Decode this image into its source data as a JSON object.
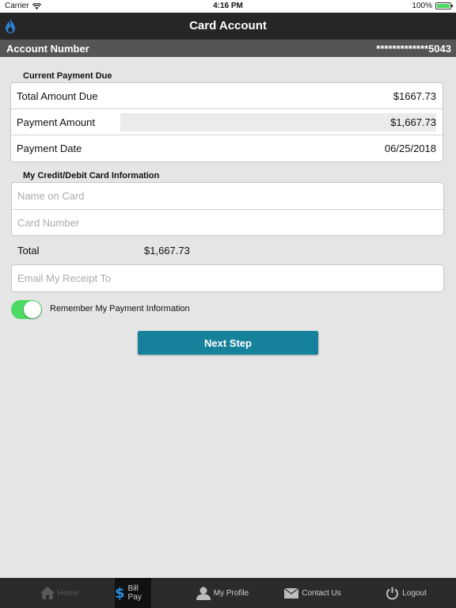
{
  "status_bar": {
    "carrier": "Carrier",
    "time": "4:16 PM",
    "battery": "100%"
  },
  "nav": {
    "title": "Card Account",
    "logo_icon": "flame-icon"
  },
  "account": {
    "label": "Account Number",
    "value": "*************5043"
  },
  "payment_due": {
    "heading": "Current Payment Due",
    "total_label": "Total Amount Due",
    "total_value": "$1667.73",
    "amount_label": "Payment Amount",
    "amount_value": "$1,667.73",
    "date_label": "Payment Date",
    "date_value": "06/25/2018"
  },
  "card_info": {
    "heading": "My Credit/Debit Card Information",
    "name_placeholder": "Name on Card",
    "number_placeholder": "Card Number"
  },
  "total": {
    "label": "Total",
    "value": "$1,667.73"
  },
  "receipt": {
    "placeholder": "Email My Receipt To"
  },
  "remember": {
    "label": "Remember My Payment Information",
    "enabled": true
  },
  "next_button": "Next Step",
  "colors": {
    "accent": "#16819a",
    "toggle_on": "#4cd964",
    "nav_bg": "#262626",
    "account_bg": "#555555"
  },
  "tabs": [
    {
      "label": "Home",
      "icon": "home-icon",
      "state": "disabled"
    },
    {
      "label": "Bill Pay",
      "icon": "dollar-icon",
      "state": "active"
    },
    {
      "label": "My Profile",
      "icon": "person-icon",
      "state": "normal"
    },
    {
      "label": "Contact Us",
      "icon": "envelope-icon",
      "state": "normal"
    },
    {
      "label": "Logout",
      "icon": "power-icon",
      "state": "normal"
    }
  ]
}
